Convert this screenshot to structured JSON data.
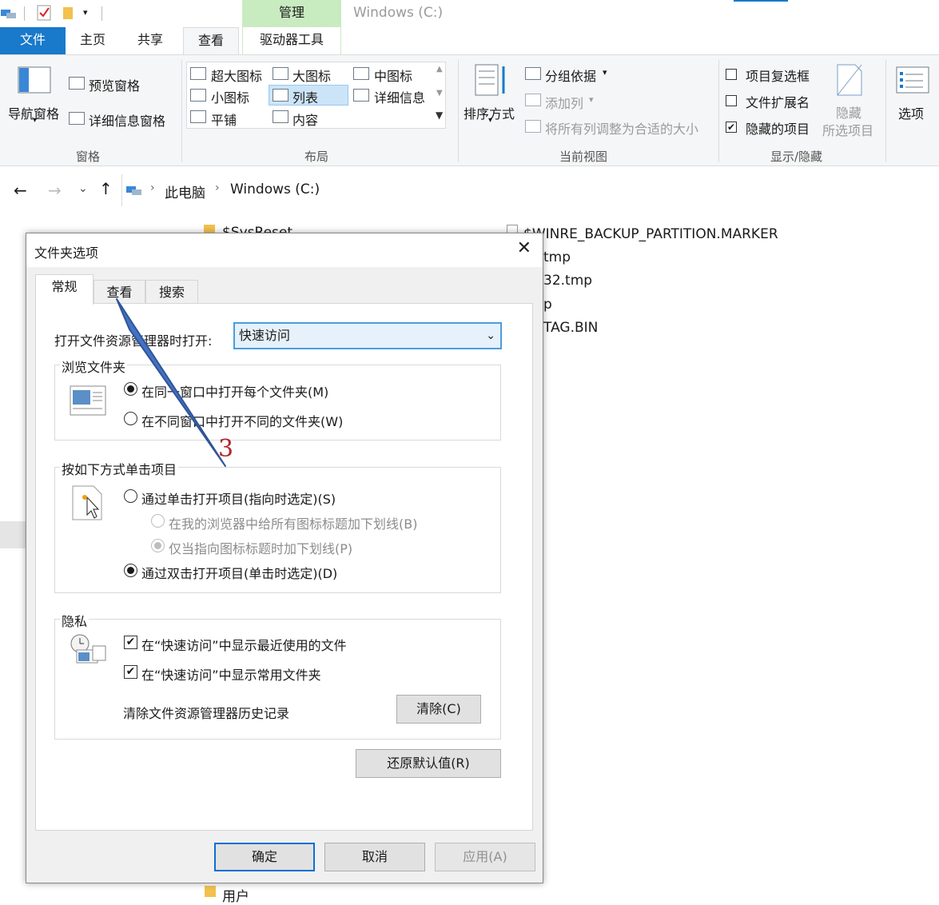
{
  "window": {
    "title": "Windows (C:)",
    "context_tab": "管理"
  },
  "ribbon_tabs": {
    "file": "文件",
    "home": "主页",
    "share": "共享",
    "view": "查看",
    "drive_tools": "驱动器工具"
  },
  "ribbon": {
    "panes": {
      "nav_pane": "导航窗格",
      "preview_pane": "预览窗格",
      "details_pane": "详细信息窗格",
      "label": "窗格"
    },
    "layout": {
      "extra_large": "超大图标",
      "large": "大图标",
      "medium": "中图标",
      "small": "小图标",
      "list": "列表",
      "details": "详细信息",
      "tiles": "平铺",
      "content": "内容",
      "label": "布局"
    },
    "current_view": {
      "sort_by": "排序方式",
      "group_by": "分组依据",
      "add_columns": "添加列",
      "size_all_columns": "将所有列调整为合适的大小",
      "label": "当前视图"
    },
    "show_hide": {
      "item_checkboxes": "项目复选框",
      "file_extensions": "文件扩展名",
      "hidden_items": "隐藏的项目",
      "hide_selected_1": "隐藏",
      "hide_selected_2": "所选项目",
      "label": "显示/隐藏",
      "item_checkboxes_checked": false,
      "file_extensions_checked": false,
      "hidden_items_checked": true
    },
    "options": "选项"
  },
  "address": {
    "crumbs": [
      "此电脑",
      "Windows (C:)"
    ]
  },
  "files": {
    "left_top": "$SysReset",
    "right": [
      "$WINRE_BACKUP_PARTITION.MARKER",
      "tmp",
      "32.tmp",
      "p",
      "TAG.BIN"
    ],
    "bottom": "用户"
  },
  "dialog": {
    "title": "文件夹选项",
    "tabs": [
      "常规",
      "查看",
      "搜索"
    ],
    "open_label": "打开文件资源管理器时打开:",
    "open_value": "快速访问",
    "browse": {
      "title": "浏览文件夹",
      "same_window": "在同一窗口中打开每个文件夹(M)",
      "new_window": "在不同窗口中打开不同的文件夹(W)"
    },
    "click": {
      "title": "按如下方式单击项目",
      "single_click": "通过单击打开项目(指向时选定)(S)",
      "underline_all": "在我的浏览器中给所有图标标题加下划线(B)",
      "underline_point": "仅当指向图标标题时加下划线(P)",
      "double_click": "通过双击打开项目(单击时选定)(D)"
    },
    "privacy": {
      "title": "隐私",
      "recent_files": "在“快速访问”中显示最近使用的文件",
      "frequent_folders": "在“快速访问”中显示常用文件夹",
      "clear_history": "清除文件资源管理器历史记录",
      "clear_button": "清除(C)"
    },
    "restore_defaults": "还原默认值(R)",
    "ok": "确定",
    "cancel": "取消",
    "apply": "应用(A)"
  },
  "annotation": {
    "number": "3",
    "color": "#b3262b"
  }
}
